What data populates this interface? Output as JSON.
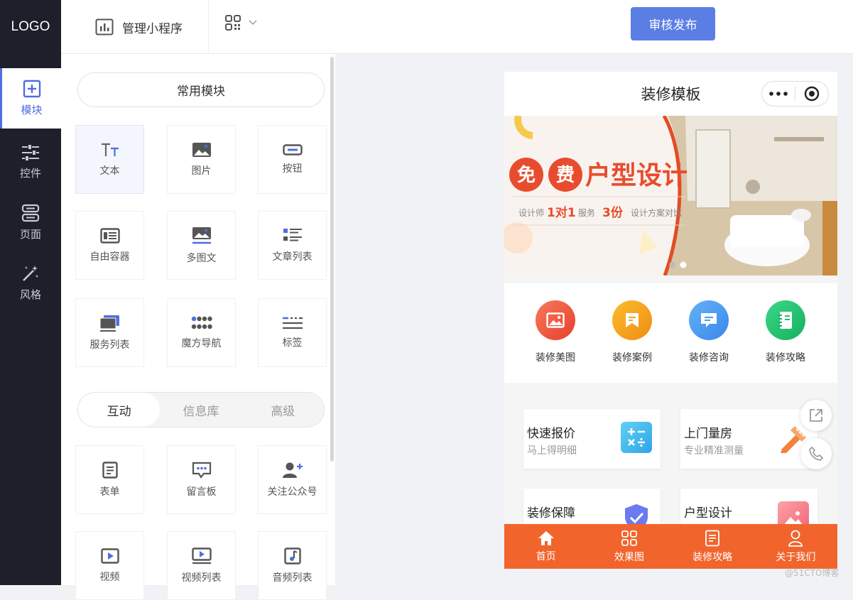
{
  "topbar": {
    "logo": "LOGO",
    "manage_label": "管理小程序",
    "publish_label": "审核发布"
  },
  "leftnav": {
    "items": [
      {
        "label": "模块",
        "icon": "plus-square-icon"
      },
      {
        "label": "控件",
        "icon": "sliders-icon"
      },
      {
        "label": "页面",
        "icon": "pages-icon"
      },
      {
        "label": "风格",
        "icon": "magic-wand-icon"
      }
    ]
  },
  "panel": {
    "common_section": "常用模块",
    "common_modules": [
      {
        "label": "文本",
        "icon": "text-icon"
      },
      {
        "label": "图片",
        "icon": "image-icon"
      },
      {
        "label": "按钮",
        "icon": "button-icon"
      },
      {
        "label": "自由容器",
        "icon": "container-icon"
      },
      {
        "label": "多图文",
        "icon": "multi-image-text-icon"
      },
      {
        "label": "文章列表",
        "icon": "article-list-icon"
      },
      {
        "label": "服务列表",
        "icon": "service-list-icon"
      },
      {
        "label": "魔方导航",
        "icon": "grid-nav-icon"
      },
      {
        "label": "标签",
        "icon": "tag-icon"
      }
    ],
    "tabs": [
      {
        "label": "互动"
      },
      {
        "label": "信息库"
      },
      {
        "label": "高级"
      }
    ],
    "interact_modules": [
      {
        "label": "表单",
        "icon": "form-icon"
      },
      {
        "label": "留言板",
        "icon": "message-board-icon"
      },
      {
        "label": "关注公众号",
        "icon": "follow-account-icon"
      },
      {
        "label": "视频",
        "icon": "video-icon"
      },
      {
        "label": "视频列表",
        "icon": "video-list-icon"
      },
      {
        "label": "音频列表",
        "icon": "audio-list-icon"
      }
    ]
  },
  "phone": {
    "title": "装修模板",
    "banner": {
      "headline_chars": [
        "免",
        "费"
      ],
      "headline_rest": "户型设计",
      "sub_a": "设计师",
      "sub_b": "1对1",
      "sub_c": "服务",
      "sub_d": "3份",
      "sub_e": "设计方案对比"
    },
    "quick_nav": [
      {
        "label": "装修美图",
        "color": "#f15a3c"
      },
      {
        "label": "装修案例",
        "color": "#f6a21c"
      },
      {
        "label": "装修咨询",
        "color": "#4a9bf0"
      },
      {
        "label": "装修攻略",
        "color": "#1fbf6a"
      }
    ],
    "cards": [
      {
        "title": "快速报价",
        "sub": "马上得明细"
      },
      {
        "title": "上门量房",
        "sub": "专业精准测量"
      },
      {
        "title": "装修保障",
        "sub": ""
      },
      {
        "title": "户型设计",
        "sub": ""
      }
    ],
    "tabbar": [
      {
        "label": "首页",
        "icon": "home-icon"
      },
      {
        "label": "效果图",
        "icon": "grid-icon"
      },
      {
        "label": "装修攻略",
        "icon": "document-icon"
      },
      {
        "label": "关于我们",
        "icon": "user-icon"
      }
    ]
  },
  "watermark": "@51CTO博客",
  "colors": {
    "accent": "#5b7ee5",
    "nav_bg": "#1d1f2b",
    "tabbar": "#f1652d"
  }
}
